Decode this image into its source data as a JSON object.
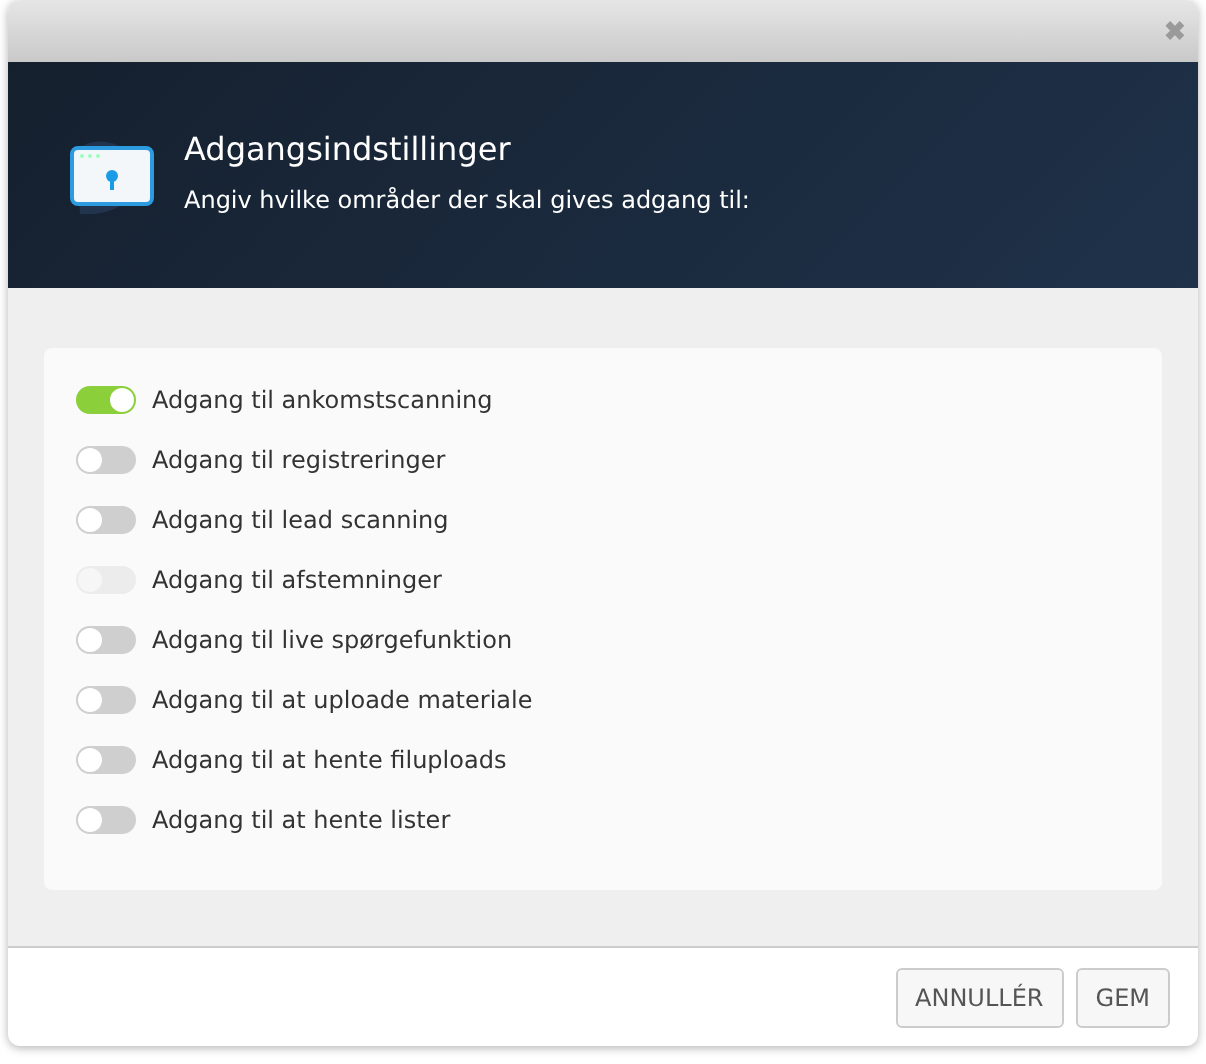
{
  "dialog": {
    "close": "✖",
    "title": "Adgangsindstillinger",
    "subtitle": "Angiv hvilke områder der skal gives adgang til:"
  },
  "toggles": [
    {
      "label": "Adgang til ankomstscanning",
      "on": true,
      "disabled": false
    },
    {
      "label": "Adgang til registreringer",
      "on": false,
      "disabled": false
    },
    {
      "label": "Adgang til lead scanning",
      "on": false,
      "disabled": false
    },
    {
      "label": "Adgang til afstemninger",
      "on": false,
      "disabled": true
    },
    {
      "label": "Adgang til live spørgefunktion",
      "on": false,
      "disabled": false
    },
    {
      "label": "Adgang til at uploade materiale",
      "on": false,
      "disabled": false
    },
    {
      "label": "Adgang til at hente filuploads",
      "on": false,
      "disabled": false
    },
    {
      "label": "Adgang til at hente lister",
      "on": false,
      "disabled": false
    }
  ],
  "buttons": [
    "ANNULLÉR",
    "GEM"
  ]
}
